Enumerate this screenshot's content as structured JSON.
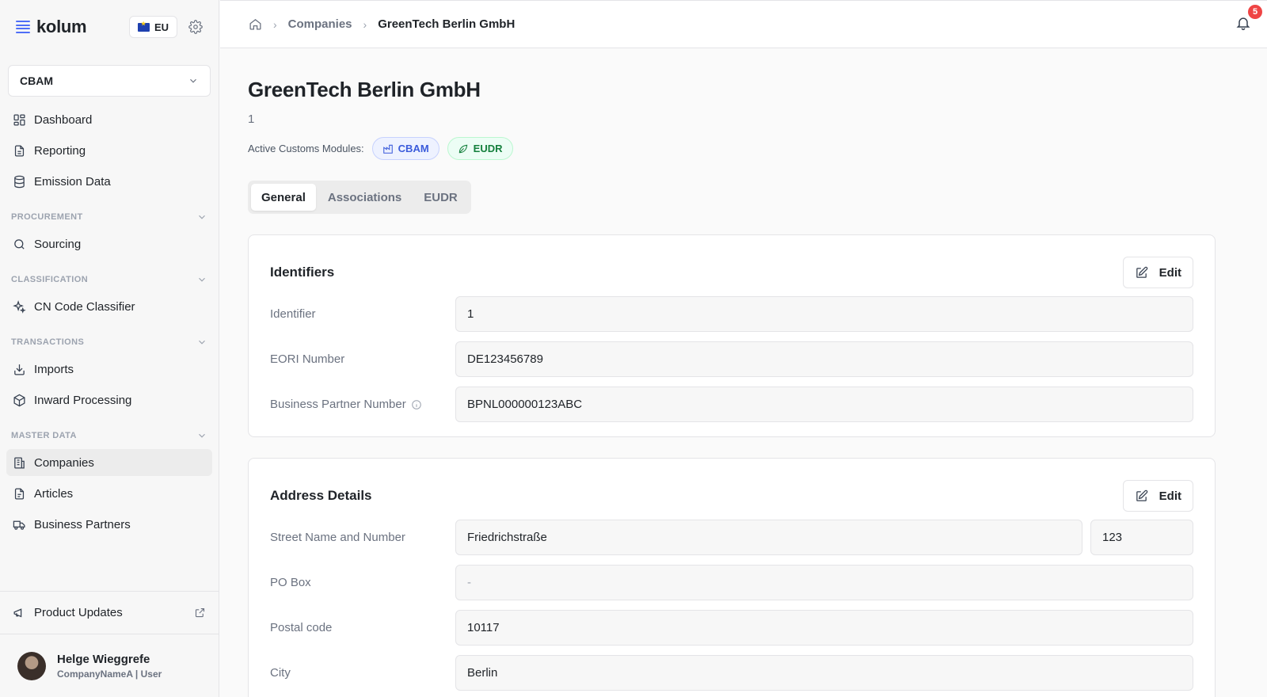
{
  "brand": {
    "name": "kolum",
    "region": "EU"
  },
  "module_select": {
    "value": "CBAM"
  },
  "nav": {
    "top": [
      {
        "label": "Dashboard",
        "icon": "dashboard-icon"
      },
      {
        "label": "Reporting",
        "icon": "document-icon"
      },
      {
        "label": "Emission Data",
        "icon": "database-icon"
      }
    ],
    "procurement": {
      "title": "PROCUREMENT",
      "items": [
        {
          "label": "Sourcing",
          "icon": "search-icon"
        }
      ]
    },
    "classification": {
      "title": "CLASSIFICATION",
      "items": [
        {
          "label": "CN Code Classifier",
          "icon": "sparkles-icon"
        }
      ]
    },
    "transactions": {
      "title": "TRANSACTIONS",
      "items": [
        {
          "label": "Imports",
          "icon": "import-icon"
        },
        {
          "label": "Inward Processing",
          "icon": "package-icon"
        }
      ]
    },
    "master_data": {
      "title": "MASTER DATA",
      "items": [
        {
          "label": "Companies",
          "icon": "building-icon",
          "active": true
        },
        {
          "label": "Articles",
          "icon": "file-icon"
        },
        {
          "label": "Business Partners",
          "icon": "truck-icon"
        }
      ]
    }
  },
  "product_updates": {
    "label": "Product Updates"
  },
  "user": {
    "name": "Helge Wieggrefe",
    "subtitle": "CompanyNameA | User"
  },
  "breadcrumb": {
    "parent": "Companies",
    "current": "GreenTech Berlin GmbH"
  },
  "notifications": {
    "count": "5"
  },
  "page": {
    "title": "GreenTech Berlin GmbH",
    "subtitle": "1",
    "modules_label": "Active Customs Modules:",
    "modules": [
      {
        "label": "CBAM",
        "color": "#3b5bdb"
      },
      {
        "label": "EUDR",
        "color": "#15803d"
      }
    ]
  },
  "tabs": [
    {
      "label": "General",
      "active": true
    },
    {
      "label": "Associations"
    },
    {
      "label": "EUDR"
    }
  ],
  "identifiers": {
    "title": "Identifiers",
    "edit_label": "Edit",
    "fields": [
      {
        "label": "Identifier",
        "value": "1"
      },
      {
        "label": "EORI Number",
        "value": "DE123456789"
      },
      {
        "label": "Business Partner Number",
        "value": "BPNL000000123ABC"
      }
    ]
  },
  "address": {
    "title": "Address Details",
    "edit_label": "Edit",
    "street_label": "Street Name and Number",
    "street": "Friedrichstraße",
    "street_number": "123",
    "po_box_label": "PO Box",
    "po_box": "-",
    "postal_label": "Postal code",
    "postal": "10117",
    "city_label": "City",
    "city": "Berlin"
  }
}
